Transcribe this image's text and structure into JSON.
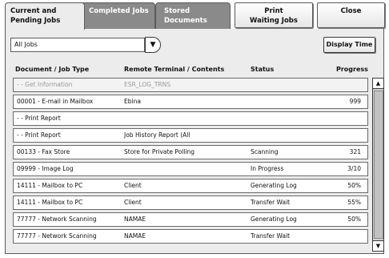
{
  "tabs": {
    "current": [
      "Current and",
      "Pending Jobs"
    ],
    "completed": [
      "Completed Jobs"
    ],
    "stored": [
      "Stored",
      "Documents"
    ]
  },
  "buttons": {
    "print_waiting": [
      "Print",
      "Waiting Jobs"
    ],
    "close": "Close",
    "display_time": "Display Time"
  },
  "filter": {
    "value": "All Jobs",
    "arrow_icon": "chevron-down-icon"
  },
  "columns": {
    "doc": "Document / Job Type",
    "remote": "Remote Terminal / Contents",
    "status": "Status",
    "progress": "Progress"
  },
  "rows": [
    {
      "doc": "-    - Get Information",
      "remote": "ESR_LOG_TRNS",
      "status": "",
      "progress": "",
      "dim": true
    },
    {
      "doc": "00001  - E-mail in Mailbox",
      "remote": "Ebina",
      "status": "",
      "progress": "999"
    },
    {
      "doc": "-    - Print Report",
      "remote": "",
      "status": "",
      "progress": ""
    },
    {
      "doc": "-    - Print Report",
      "remote": "Job History Report (All",
      "status": "",
      "progress": ""
    },
    {
      "doc": "00133  - Fax Store",
      "remote": "Store for Private Polling",
      "status": "Scanning",
      "progress": "321"
    },
    {
      "doc": "09999  - Image Log",
      "remote": "",
      "status": "In Progress",
      "progress": "3/10"
    },
    {
      "doc": "14111  - Mailbox to PC",
      "remote": "Client",
      "status": "Generating Log",
      "progress": "50%"
    },
    {
      "doc": "14111  - Mailbox to PC",
      "remote": "Client",
      "status": "Transfer Wait",
      "progress": "55%"
    },
    {
      "doc": "77777  - Network Scanning",
      "remote": "NAMAE",
      "status": "Generating Log",
      "progress": "50%"
    },
    {
      "doc": "77777  - Network Scanning",
      "remote": "NAMAE",
      "status": "Transfer Wait",
      "progress": ""
    }
  ],
  "scrollbar": {
    "up_icon": "triangle-up-icon",
    "down_icon": "triangle-down-icon"
  }
}
